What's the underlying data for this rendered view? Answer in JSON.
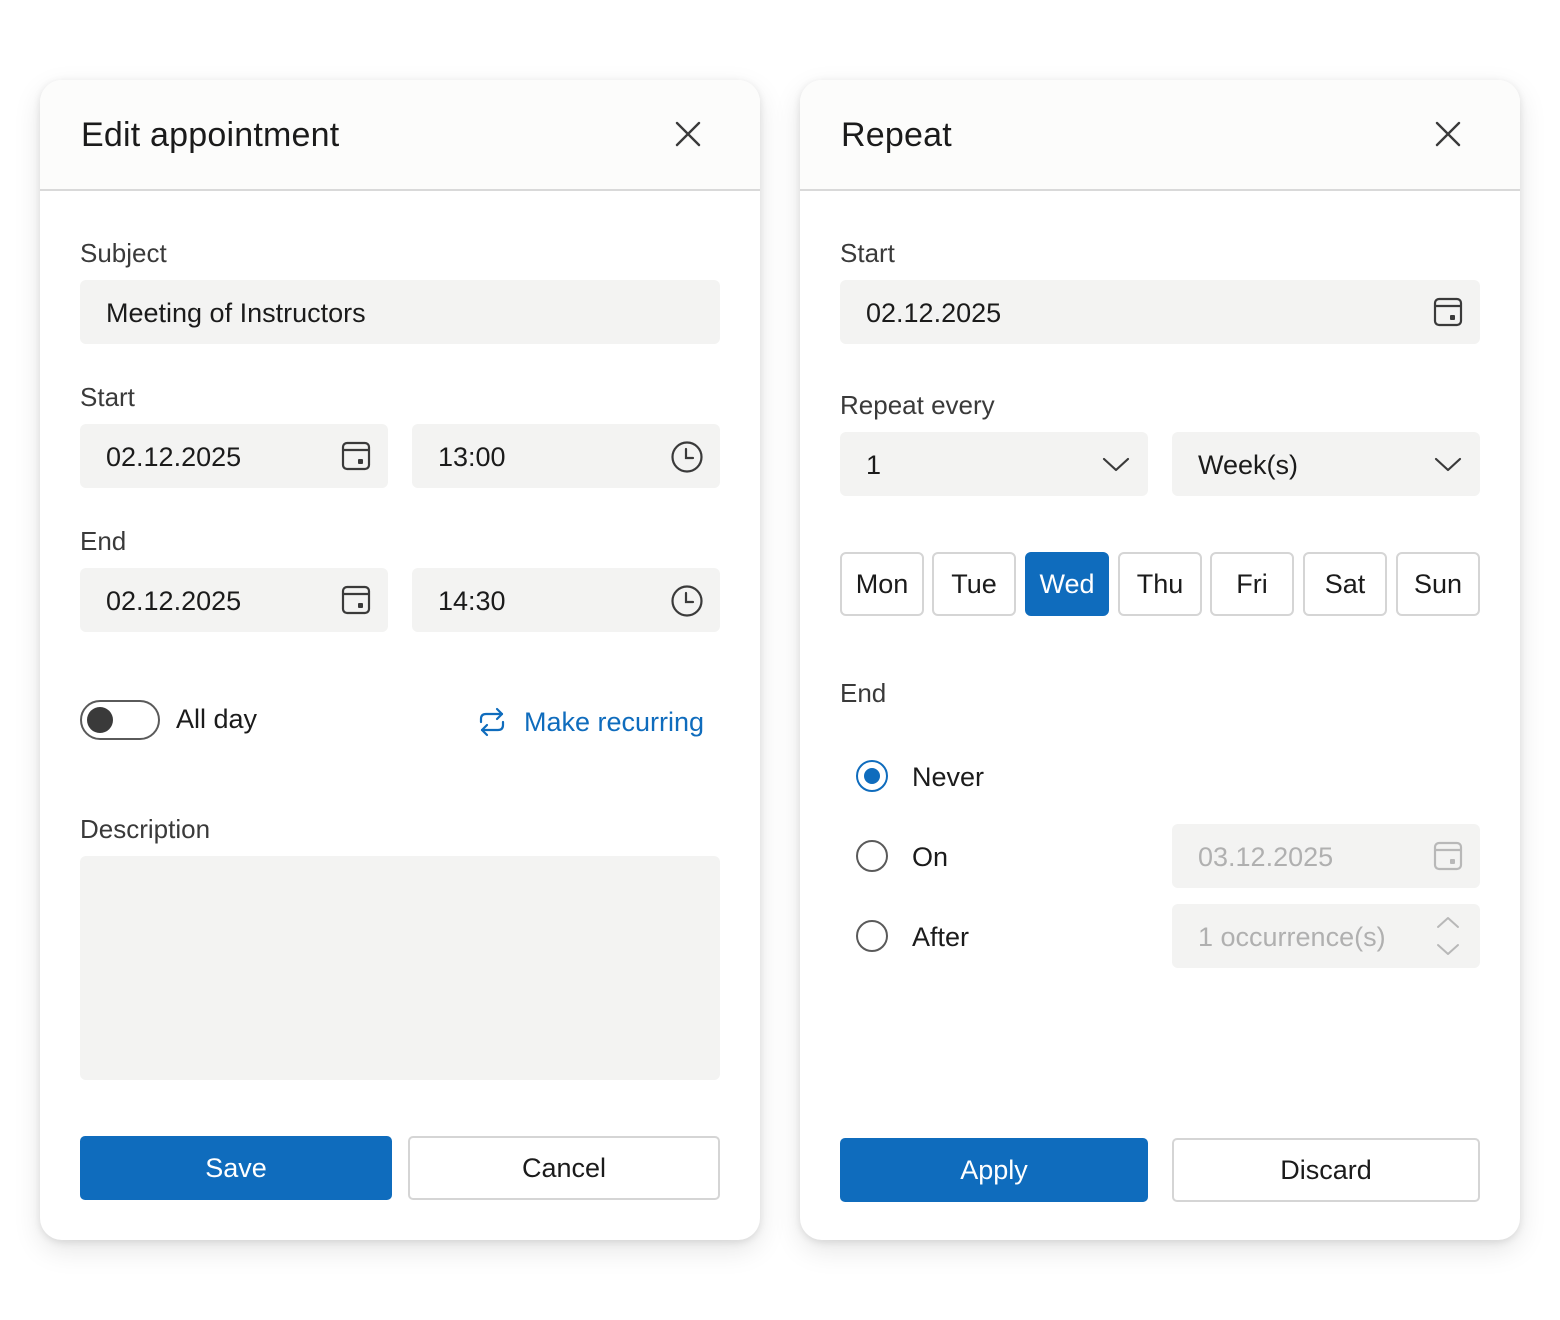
{
  "colors": {
    "accent": "#0f6cbd",
    "field_bg": "#f3f3f2",
    "disabled_text": "#b0b0b0"
  },
  "edit_dialog": {
    "title": "Edit appointment",
    "subject": {
      "label": "Subject",
      "value": "Meeting of Instructors"
    },
    "start": {
      "label": "Start",
      "date": "02.12.2025",
      "time": "13:00"
    },
    "end": {
      "label": "End",
      "date": "02.12.2025",
      "time": "14:30"
    },
    "all_day": {
      "label": "All day",
      "on": false
    },
    "make_recurring": "Make recurring",
    "description": {
      "label": "Description",
      "value": ""
    },
    "save": "Save",
    "cancel": "Cancel",
    "icons": {
      "close": "close-icon",
      "date": "calendar-icon",
      "time": "clock-icon",
      "recurring": "repeat-icon"
    }
  },
  "repeat_dialog": {
    "title": "Repeat",
    "start": {
      "label": "Start",
      "date": "02.12.2025"
    },
    "repeat_every": {
      "label": "Repeat every",
      "interval": "1",
      "unit": "Week(s)"
    },
    "days": [
      {
        "label": "Mon",
        "selected": false
      },
      {
        "label": "Tue",
        "selected": false
      },
      {
        "label": "Wed",
        "selected": true
      },
      {
        "label": "Thu",
        "selected": false
      },
      {
        "label": "Fri",
        "selected": false
      },
      {
        "label": "Sat",
        "selected": false
      },
      {
        "label": "Sun",
        "selected": false
      }
    ],
    "end": {
      "label": "End",
      "options": [
        {
          "label": "Never",
          "selected": true
        },
        {
          "label": "On",
          "selected": false
        },
        {
          "label": "After",
          "selected": false
        }
      ],
      "on_date": "03.12.2025",
      "after_count": "1 occurrence(s)"
    },
    "apply": "Apply",
    "discard": "Discard"
  }
}
